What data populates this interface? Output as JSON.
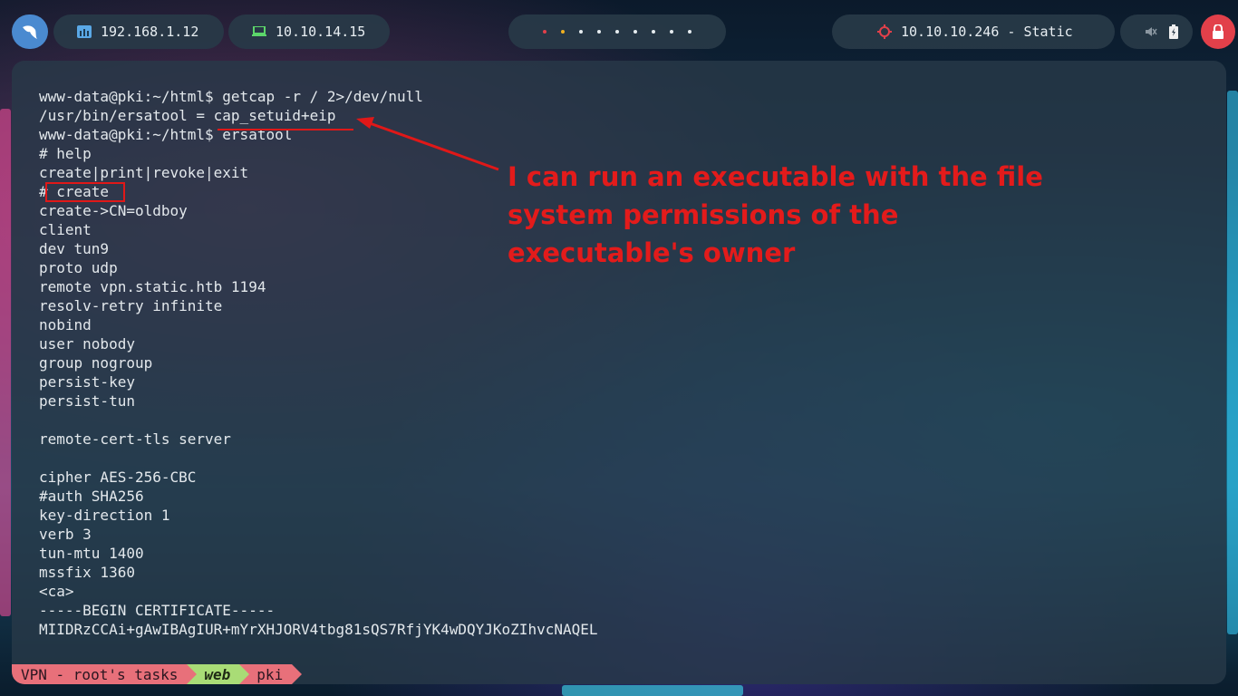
{
  "topbar": {
    "local_ip": "192.168.1.12",
    "vpn_ip": "10.10.14.15",
    "target": "10.10.10.246 - Static",
    "workspace_colors": [
      "#e2404a",
      "#f0b020",
      "#e6ecf0",
      "#e6ecf0",
      "#e6ecf0",
      "#e6ecf0",
      "#e6ecf0",
      "#e6ecf0",
      "#e6ecf0"
    ],
    "icons": {
      "logo": "shark-fin-icon",
      "local": "network-icon",
      "vpn": "laptop-icon",
      "target": "crosshair-icon",
      "mute": "muted-speaker-icon",
      "battery": "battery-icon",
      "lock": "lock-icon"
    },
    "accent_colors": {
      "logo": "#4a8ad0",
      "lock": "#e2404a",
      "target_icon": "#e2404a",
      "vpn_icon": "#5cd66a",
      "local_icon": "#5aa8e6"
    }
  },
  "terminal": {
    "lines": [
      "www-data@pki:~/html$ getcap -r / 2>/dev/null",
      "/usr/bin/ersatool = cap_setuid+eip",
      "www-data@pki:~/html$ ersatool",
      "# help",
      "create|print|revoke|exit",
      "# create",
      "create->CN=oldboy",
      "client",
      "dev tun9",
      "proto udp",
      "remote vpn.static.htb 1194",
      "resolv-retry infinite",
      "nobind",
      "user nobody",
      "group nogroup",
      "persist-key",
      "persist-tun",
      "",
      "remote-cert-tls server",
      "",
      "cipher AES-256-CBC",
      "#auth SHA256",
      "key-direction 1",
      "verb 3",
      "tun-mtu 1400",
      "mssfix 1360",
      "<ca>",
      "-----BEGIN CERTIFICATE-----",
      "MIIDRzCCAi+gAwIBAgIUR+mYrXHJORV4tbg81sQS7RfjYK4wDQYJKoZIhvcNAQEL"
    ],
    "annotation": "I can run an executable with the file system permissions of the executable's owner",
    "annotation_color": "#e31b1b"
  },
  "statusline": {
    "session": "VPN - root's tasks",
    "window": "web",
    "pane": "pki"
  }
}
